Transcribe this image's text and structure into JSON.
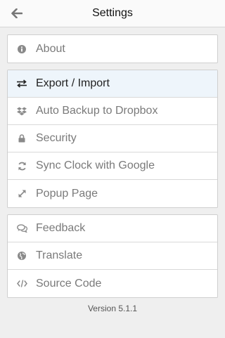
{
  "header": {
    "title": "Settings",
    "back_icon": "arrow-left-icon"
  },
  "groups": [
    {
      "items": [
        {
          "label": "About",
          "icon": "info-circle-icon"
        }
      ]
    },
    {
      "items": [
        {
          "label": "Export / Import",
          "icon": "exchange-icon",
          "active": true
        },
        {
          "label": "Auto Backup to Dropbox",
          "icon": "dropbox-icon"
        },
        {
          "label": "Security",
          "icon": "lock-icon"
        },
        {
          "label": "Sync Clock with Google",
          "icon": "refresh-icon"
        },
        {
          "label": "Popup Page",
          "icon": "expand-icon"
        }
      ]
    },
    {
      "items": [
        {
          "label": "Feedback",
          "icon": "comments-icon"
        },
        {
          "label": "Translate",
          "icon": "globe-icon"
        },
        {
          "label": "Source Code",
          "icon": "code-icon"
        }
      ]
    }
  ],
  "footer": {
    "version": "Version 5.1.1"
  },
  "colors": {
    "active_row_bg": "#eef5fb",
    "icon_gray": "#8a8a8a",
    "label_gray": "#7a7a7a",
    "page_bg": "#efefef"
  }
}
